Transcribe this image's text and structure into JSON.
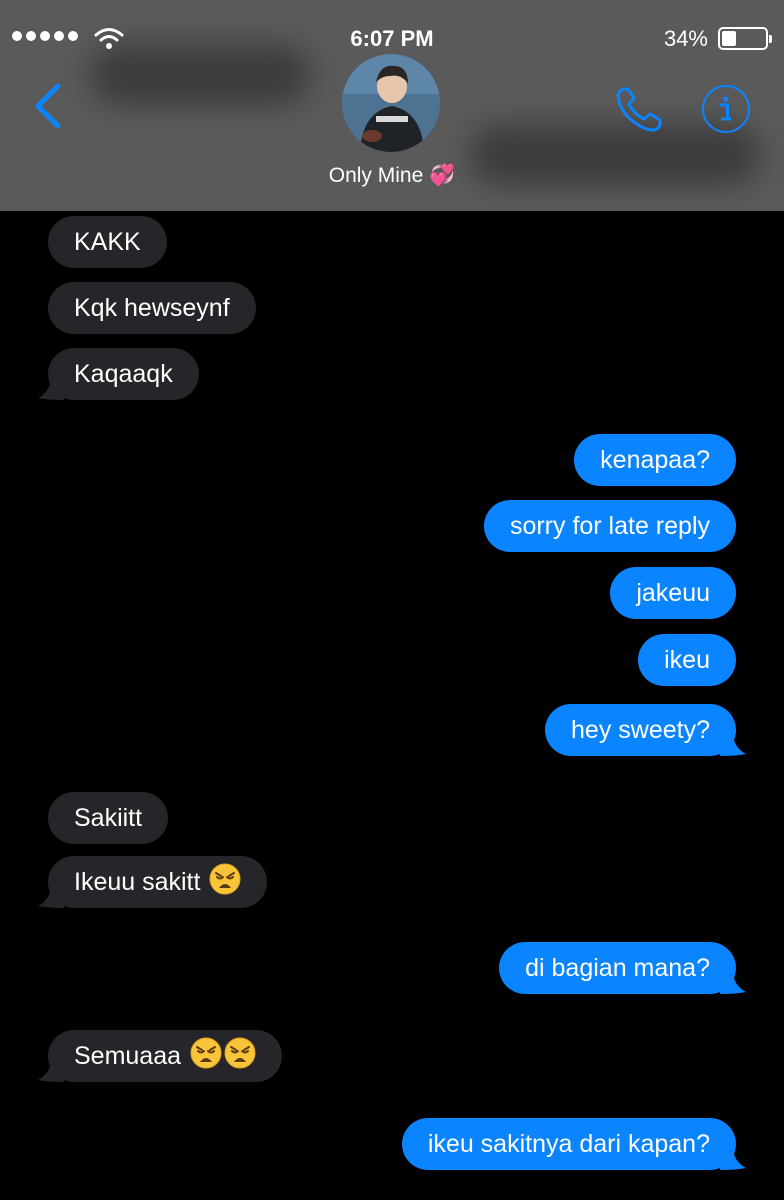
{
  "status_bar": {
    "time": "6:07 PM",
    "battery": "34%",
    "battery_level": 0.34
  },
  "contact": {
    "name": "Only Mine 💞"
  },
  "colors": {
    "accent": "#0a84ff",
    "incoming_bubble": "#26252a",
    "outgoing_bubble": "#0a84ff",
    "header_bg": "#5a5a5a"
  },
  "icons": {
    "back": "chevron-left-icon",
    "call": "phone-icon",
    "info": "info-icon",
    "emoji": "weary-face-emoji"
  },
  "messages": [
    {
      "from": "them",
      "text": "KAKK"
    },
    {
      "from": "them",
      "text": "Kqk hewseynf"
    },
    {
      "from": "them",
      "text": "Kaqaaqk"
    },
    {
      "from": "me",
      "text": "kenapaa?"
    },
    {
      "from": "me",
      "text": "sorry for late reply"
    },
    {
      "from": "me",
      "text": "jakeuu"
    },
    {
      "from": "me",
      "text": "ikeu"
    },
    {
      "from": "me",
      "text": "hey sweety?"
    },
    {
      "from": "them",
      "text": "Sakiitt"
    },
    {
      "from": "them",
      "text": "Ikeuu sakitt",
      "emoji_count": 1
    },
    {
      "from": "me",
      "text": "di bagian mana?"
    },
    {
      "from": "them",
      "text": "Semuaaa",
      "emoji_count": 2
    },
    {
      "from": "me",
      "text": "ikeu sakitnya dari kapan?"
    }
  ]
}
